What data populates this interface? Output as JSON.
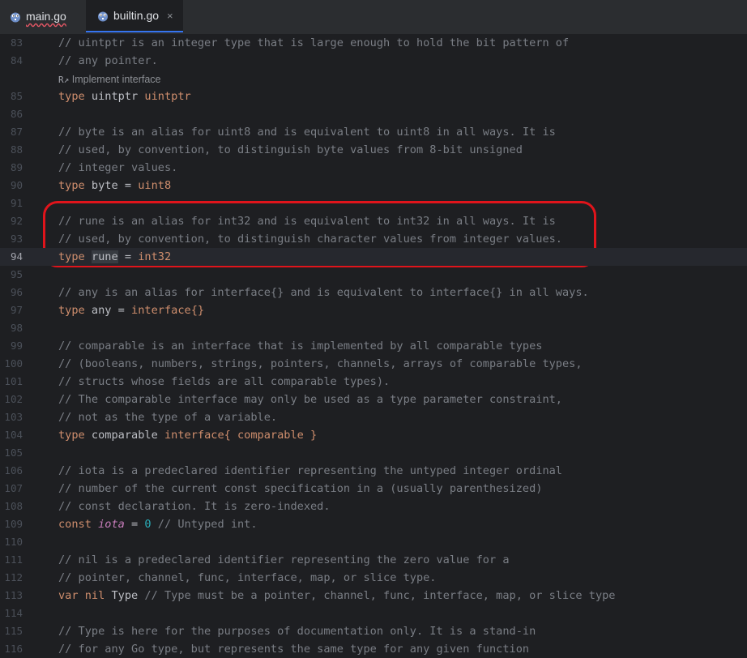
{
  "tabs": [
    {
      "label": "main.go",
      "icon": "gopher-icon",
      "active": false,
      "has_error": true
    },
    {
      "label": "builtin.go",
      "icon": "gopher-icon",
      "active": true,
      "close": "×"
    }
  ],
  "inlay_hint": {
    "icon": "R↗",
    "text": "Implement interface"
  },
  "colors": {
    "annotation": "#e0141b",
    "keyword": "#cf8e6d",
    "comment": "#7a7e85",
    "number": "#2aacb8"
  },
  "lines": [
    {
      "num": "83",
      "c1": "// uintptr is an integer type that is large enough to hold the bit pattern of"
    },
    {
      "num": "84",
      "c1": "// any pointer."
    },
    {
      "num": "85",
      "k1": "type",
      "t1": " uintptr ",
      "k2": "uintptr"
    },
    {
      "num": "86"
    },
    {
      "num": "87",
      "c1": "// byte is an alias for uint8 and is equivalent to uint8 in all ways. It is"
    },
    {
      "num": "88",
      "c1": "// used, by convention, to distinguish byte values from 8-bit unsigned"
    },
    {
      "num": "89",
      "c1": "// integer values."
    },
    {
      "num": "90",
      "k1": "type",
      "t1": " byte = ",
      "k2": "uint8"
    },
    {
      "num": "91"
    },
    {
      "num": "92",
      "c1": "// rune is an alias for int32 and is equivalent to int32 in all ways. It is"
    },
    {
      "num": "93",
      "c1": "// used, by convention, to distinguish character values from integer values."
    },
    {
      "num": "94",
      "k1": "type",
      "t1": " ",
      "hl": "rune",
      "t2": " = ",
      "k2": "int32"
    },
    {
      "num": "95"
    },
    {
      "num": "96",
      "c1": "// any is an alias for interface{} and is equivalent to interface{} in all ways."
    },
    {
      "num": "97",
      "k1": "type",
      "t1": " any = ",
      "k2": "interface{}"
    },
    {
      "num": "98"
    },
    {
      "num": "99",
      "c1": "// comparable is an interface that is implemented by all comparable types"
    },
    {
      "num": "100",
      "c1": "// (booleans, numbers, strings, pointers, channels, arrays of comparable types,"
    },
    {
      "num": "101",
      "c1": "// structs whose fields are all comparable types)."
    },
    {
      "num": "102",
      "c1": "// The comparable interface may only be used as a type parameter constraint,"
    },
    {
      "num": "103",
      "c1": "// not as the type of a variable."
    },
    {
      "num": "104",
      "k1": "type",
      "t1": " comparable ",
      "k2": "interface{ comparable }"
    },
    {
      "num": "105"
    },
    {
      "num": "106",
      "c1": "// iota is a predeclared identifier representing the untyped integer ordinal"
    },
    {
      "num": "107",
      "c1": "// number of the current const specification in a (usually parenthesized)"
    },
    {
      "num": "108",
      "c1": "// const declaration. It is zero-indexed."
    },
    {
      "num": "109",
      "k1": "const",
      "t1": " ",
      "it": "iota",
      "t2": " = ",
      "n": "0",
      "c2": " // Untyped int."
    },
    {
      "num": "110"
    },
    {
      "num": "111",
      "c1": "// nil is a predeclared identifier representing the zero value for a"
    },
    {
      "num": "112",
      "c1": "// pointer, channel, func, interface, map, or slice type."
    },
    {
      "num": "113",
      "k1": "var",
      "t1": " ",
      "k3": "nil",
      "t3": " Type",
      "c2": " // Type must be a pointer, channel, func, interface, map, or slice type"
    },
    {
      "num": "114"
    },
    {
      "num": "115",
      "c1": "// Type is here for the purposes of documentation only. It is a stand-in"
    },
    {
      "num": "116",
      "c1": "// for any Go type, but represents the same type for any given function"
    }
  ]
}
